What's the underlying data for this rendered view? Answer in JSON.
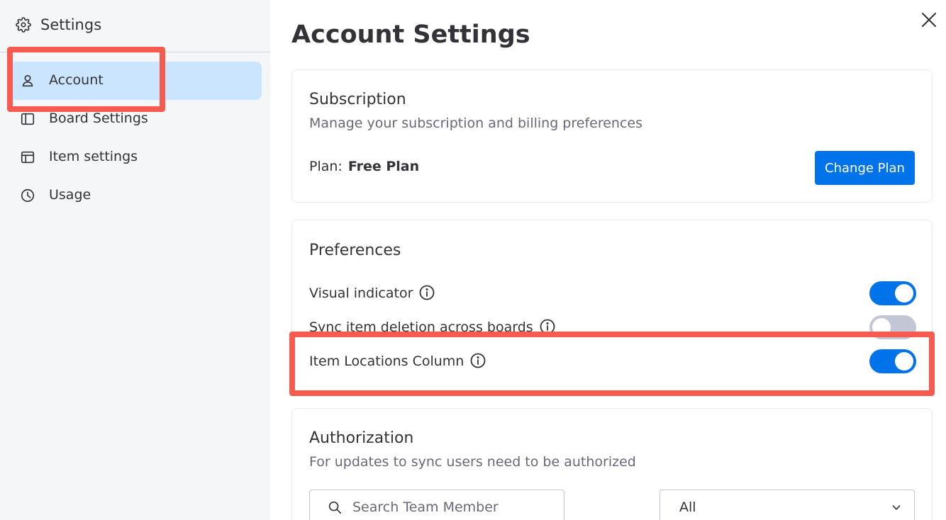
{
  "sidebar": {
    "title": "Settings",
    "items": [
      {
        "label": "Account"
      },
      {
        "label": "Board Settings"
      },
      {
        "label": "Item settings"
      },
      {
        "label": "Usage"
      }
    ]
  },
  "main": {
    "title": "Account Settings",
    "subscription": {
      "title": "Subscription",
      "subtitle": "Manage your subscription and billing preferences",
      "plan_label": "Plan:",
      "plan_value": "Free Plan",
      "change_plan_label": "Change Plan"
    },
    "preferences": {
      "title": "Preferences",
      "items": [
        {
          "label": "Visual indicator",
          "enabled": true
        },
        {
          "label": "Sync item deletion across boards",
          "enabled": false
        },
        {
          "label": "Item Locations Column",
          "enabled": true
        }
      ]
    },
    "authorization": {
      "title": "Authorization",
      "subtitle": "For updates to sync users need to be authorized",
      "search_placeholder": "Search Team Member",
      "filter_value": "All"
    }
  },
  "colors": {
    "accent": "#0073ea",
    "highlight": "#f75a4f",
    "active_nav": "#cce5ff",
    "sidebar_bg": "#f5f6f8"
  }
}
